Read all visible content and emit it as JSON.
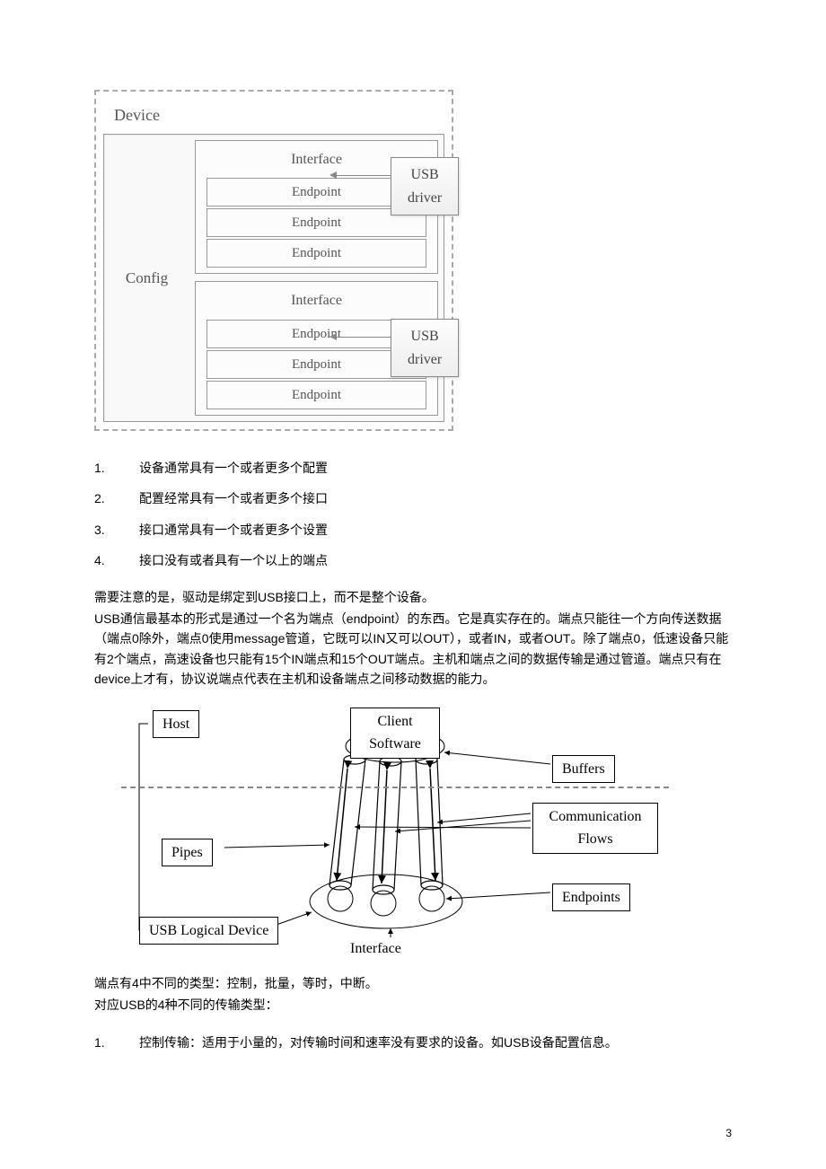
{
  "diagram1": {
    "device": "Device",
    "config": "Config",
    "interface": "Interface",
    "endpoint": "Endpoint",
    "usb_driver": "USB\ndriver"
  },
  "list1": [
    {
      "num": "1.",
      "text": "设备通常具有一个或者更多个配置"
    },
    {
      "num": "2.",
      "text": "配置经常具有一个或者更多个接口"
    },
    {
      "num": "3.",
      "text": "接口通常具有一个或者更多个设置"
    },
    {
      "num": "4.",
      "text": "接口没有或者具有一个以上的端点"
    }
  ],
  "paragraphs": {
    "p1": "需要注意的是，驱动是绑定到USB接口上，而不是整个设备。",
    "p2": "USB通信最基本的形式是通过一个名为端点（endpoint）的东西。它是真实存在的。端点只能往一个方向传送数据（端点0除外，端点0使用message管道，它既可以IN又可以OUT），或者IN，或者OUT。除了端点0，低速设备只能有2个端点，高速设备也只能有15个IN端点和15个OUT端点。主机和端点之间的数据传输是通过管道。端点只有在device上才有，协议说端点代表在主机和设备端点之间移动数据的能力。"
  },
  "diagram2": {
    "host": "Host",
    "client": "Client\nSoftware",
    "buffers": "Buffers",
    "comm_flows": "Communication\nFlows",
    "pipes": "Pipes",
    "endpoints": "Endpoints",
    "usb_logical_device": "USB Logical Device",
    "interface": "Interface"
  },
  "paragraphs2": {
    "p3": "端点有4中不同的类型：控制，批量，等时，中断。",
    "p4": "对应USB的4种不同的传输类型："
  },
  "list2": [
    {
      "num": "1.",
      "text": "控制传输：适用于小量的，对传输时间和速率没有要求的设备。如USB设备配置信息。"
    }
  ],
  "page_number": "3"
}
